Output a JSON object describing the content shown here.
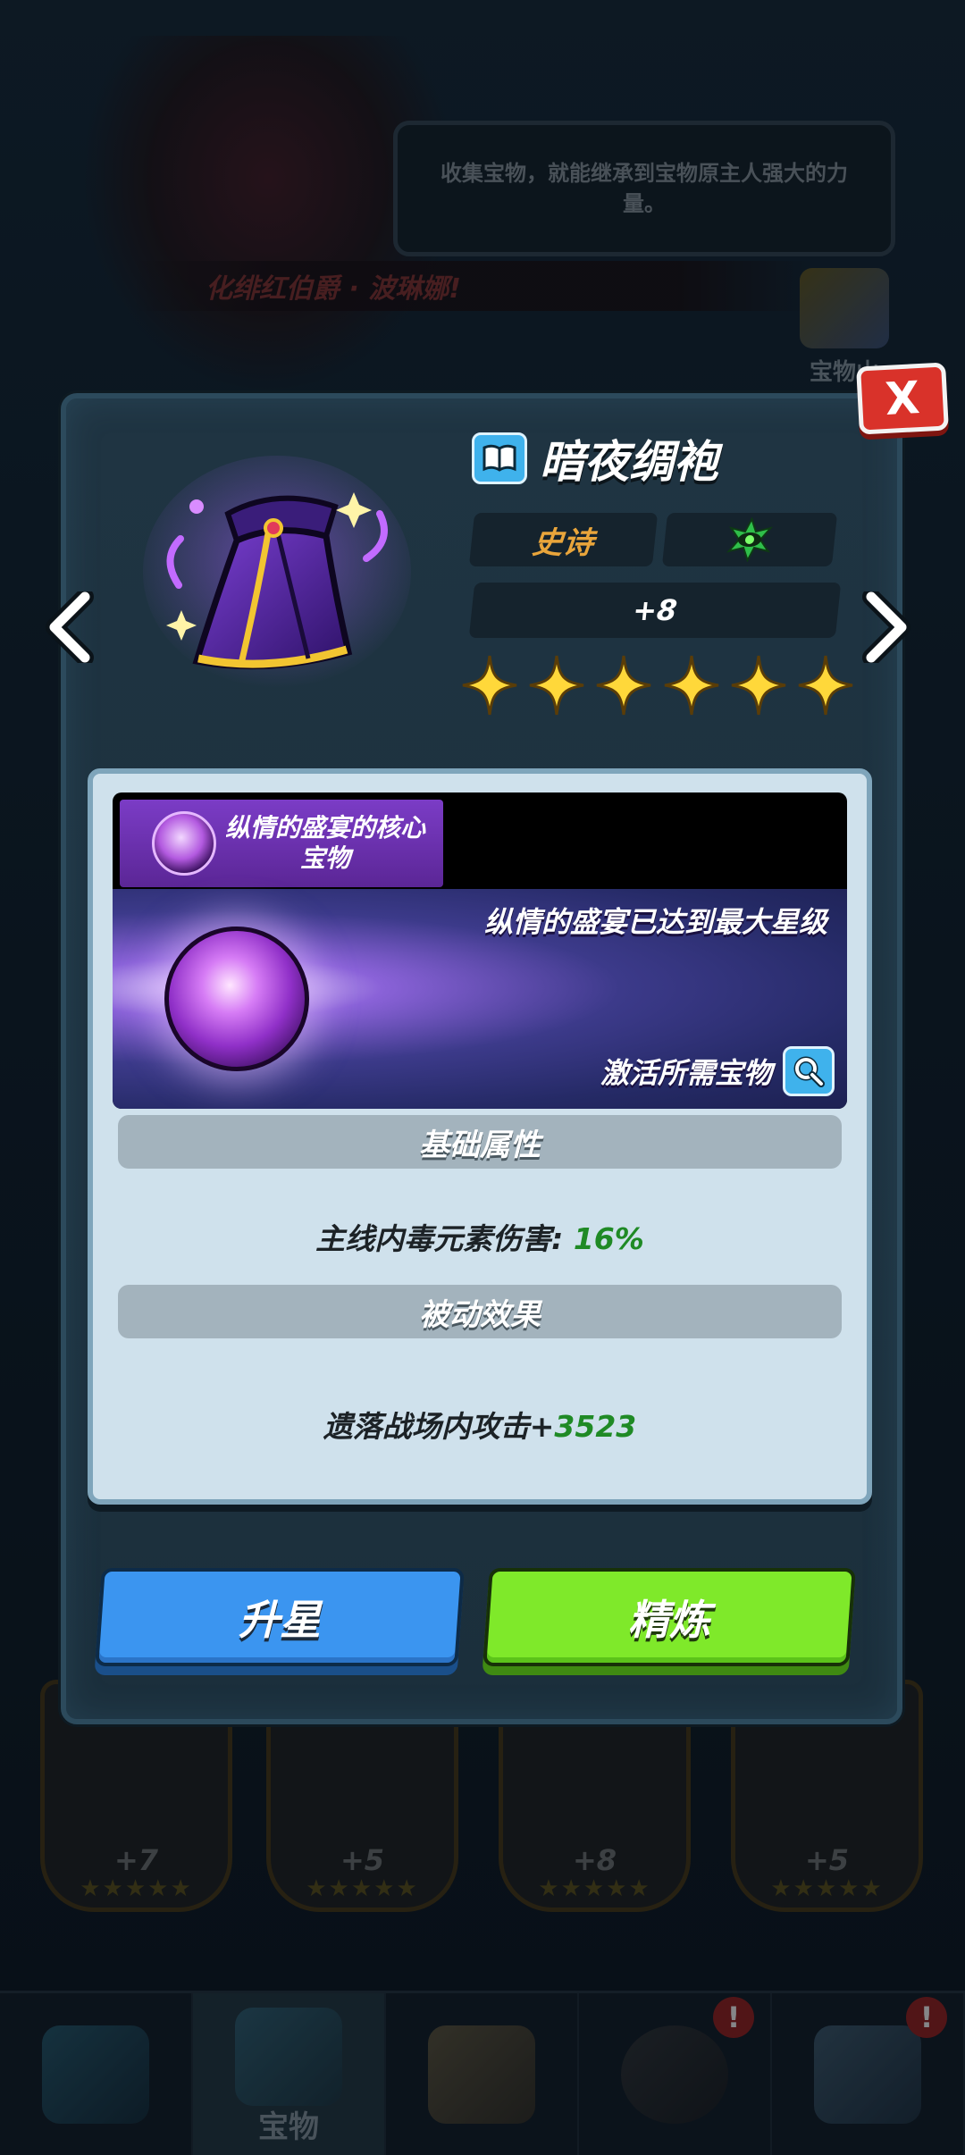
{
  "background": {
    "tip_text": "收集宝物，就能继承到宝物原主人强大的力量。",
    "banner_text": "化绯红伯爵 · 波琳娜!",
    "vault_label": "宝物山",
    "cards": [
      {
        "level": "+7"
      },
      {
        "level": "+5"
      },
      {
        "level": "+8"
      },
      {
        "level": "+5"
      }
    ]
  },
  "bottom_nav": {
    "items": [
      {
        "name": "hero",
        "label": "",
        "badge": ""
      },
      {
        "name": "treasure",
        "label": "宝物",
        "badge": ""
      },
      {
        "name": "map",
        "label": "",
        "badge": ""
      },
      {
        "name": "character",
        "label": "",
        "badge": "!"
      },
      {
        "name": "base",
        "label": "",
        "badge": "!"
      }
    ]
  },
  "modal": {
    "close_label": "X",
    "item": {
      "name": "暗夜绸袍",
      "rarity": "史诗",
      "level": "+8",
      "star_count": 6,
      "element_icon": "poison-eye-icon"
    },
    "core": {
      "tag": "纵情的盛宴的核心宝物",
      "max_star_text": "纵情的盛宴已达到最大星级",
      "required_label": "激活所需宝物"
    },
    "base_attr_title": "基础属性",
    "base_attr": {
      "label": "主线内毒元素伤害: ",
      "value": "16%"
    },
    "passive_title": "被动效果",
    "passive": {
      "label": "遗落战场内攻击+",
      "value": "3523"
    },
    "buttons": {
      "upgrade_star": "升星",
      "refine": "精炼"
    }
  },
  "colors": {
    "rarity": "#e9a53b",
    "value_green": "#1f8a25",
    "btn_blue": "#3b95f0",
    "btn_green": "#7fe92a",
    "close_red": "#d9322a"
  }
}
